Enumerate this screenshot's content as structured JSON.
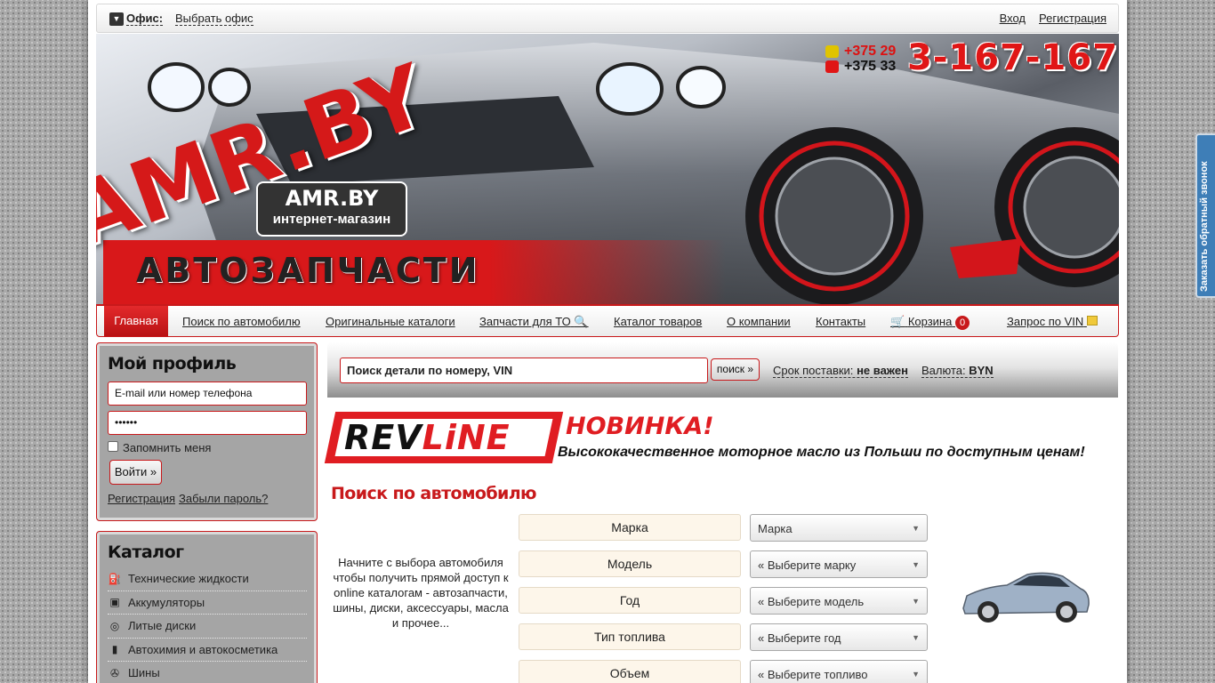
{
  "topbar": {
    "office_label": "Офис:",
    "office_choose": "Выбрать офис",
    "login": "Вход",
    "register": "Регистрация"
  },
  "banner": {
    "phone_code_1": "+375 29",
    "phone_code_2": "+375 33",
    "phone_main": "3-167-167",
    "logo": "AMR.BY",
    "badge_title": "AMR.BY",
    "badge_subtitle": "интернет-магазин",
    "slogan": "АВТОЗАПЧАСТИ"
  },
  "nav": {
    "home": "Главная",
    "car_search": "Поиск по автомобилю",
    "original_catalogs": "Оригинальные каталоги",
    "to_parts": "Запчасти для ТО",
    "goods_catalog": "Каталог товаров",
    "about": "О компании",
    "contacts": "Контакты",
    "cart": "Корзина",
    "cart_count": "0",
    "vin_request": "Запрос по VIN"
  },
  "profile": {
    "title": "Мой профиль",
    "login_placeholder": "E-mail или номер телефона",
    "password_value": "••••••",
    "remember": "Запомнить меня",
    "login_button": "Войти »",
    "register_link": "Регистрация",
    "forgot_link": "Забыли пароль?"
  },
  "catalog": {
    "title": "Каталог",
    "items": [
      {
        "label": " Технические жидкости",
        "icon": "fluid-icon"
      },
      {
        "label": " Аккумуляторы",
        "icon": "battery-icon"
      },
      {
        "label": " Литые диски",
        "icon": "wheel-rim-icon"
      },
      {
        "label": " Автохимия и автокосметика",
        "icon": "chemistry-icon"
      },
      {
        "label": " Шины",
        "icon": "tire-icon"
      }
    ]
  },
  "search": {
    "input_value": "Поиск детали по номеру, VIN",
    "button": "поиск »",
    "delivery_label": "Срок поставки:",
    "delivery_value": "не важен",
    "currency_label": "Валюта:",
    "currency_value": "BYN"
  },
  "promo": {
    "brand_rev": "REV",
    "brand_line": "LiNE",
    "headline": "НОВИНКА!",
    "text": "Высококачественное моторное масло из Польши по доступным ценам!"
  },
  "car_search": {
    "title": "Поиск по автомобилю",
    "intro": "Начните с выбора автомобиля чтобы получить прямой доступ к online каталогам - автозапчасти, шины, диски, аксессуары, масла и прочее...",
    "fields": [
      {
        "label": "Марка",
        "select": "Марка"
      },
      {
        "label": "Модель",
        "select": "« Выберите марку"
      },
      {
        "label": "Год",
        "select": "« Выберите модель"
      },
      {
        "label": "Тип топлива",
        "select": "« Выберите год"
      },
      {
        "label": "Объем",
        "select": "« Выберите топливо"
      }
    ]
  },
  "callback": {
    "label": "Заказать обратный звонок"
  },
  "colors": {
    "accent": "#c8191b",
    "brand_red": "#e01d22",
    "callback_blue": "#3e7eb7"
  }
}
